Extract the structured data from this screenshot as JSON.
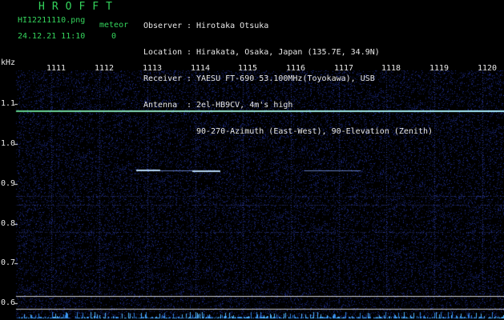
{
  "header": {
    "app_title": "HROFFT",
    "filename": "HI12211110.png",
    "meteor_label": "meteor",
    "datetime": "24.12.21 11:10",
    "meteor_count": "0"
  },
  "station_info": [
    {
      "key": "Observer",
      "sep": ":",
      "value": "Hirotaka Otsuka"
    },
    {
      "key": "Location",
      "sep": ":",
      "value": "Hirakata, Osaka, Japan (135.7E, 34.9N)"
    },
    {
      "key": "Receiver",
      "sep": ":",
      "value": "YAESU FT-690 53.100MHz(Toyokawa), USB"
    },
    {
      "key": "Antenna",
      "sep": ":",
      "value": "2el-HB9CV, 4m's high"
    },
    {
      "key": "",
      "sep": "",
      "value": "90-270-Azimuth (East-West), 90-Elevation (Zenith)"
    }
  ],
  "axis": {
    "unit": "kHz",
    "minute_ticks": [
      "1111",
      "1112",
      "1113",
      "1114",
      "1115",
      "1116",
      "1117",
      "1118",
      "1119",
      "1120"
    ],
    "freq_ticks": [
      "1.1",
      "1.0",
      "0.9",
      "0.8",
      "0.7",
      "0.6"
    ]
  },
  "colors": {
    "text_green": "#34d45c",
    "text_white": "#e8e8e8",
    "background": "#000000",
    "carrier": "#9fe8ff",
    "echo": "#bfe0ff",
    "noise": "#1a2a8a"
  }
}
